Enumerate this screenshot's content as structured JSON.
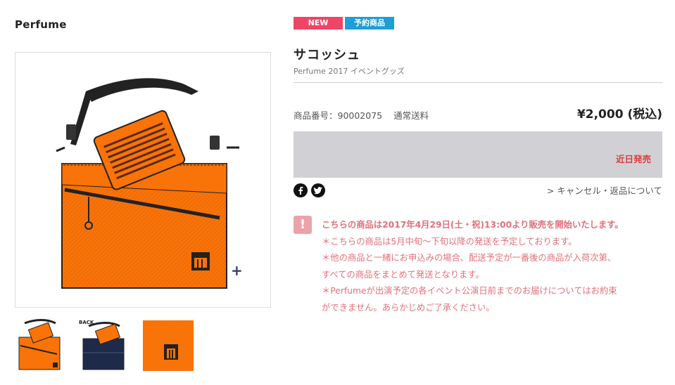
{
  "brand": "Perfume",
  "badges": {
    "new": "NEW",
    "preorder": "予約商品"
  },
  "product": {
    "title": "サコッシュ",
    "subtitle": "Perfume 2017 イベントグッズ",
    "number_label": "商品番号：90002075",
    "shipping": "通常送料",
    "price": "¥2,000 (税込)",
    "status": "近日発売"
  },
  "links": {
    "cancel": "> キャンセル・返品について"
  },
  "social": {
    "facebook_icon": "facebook-icon",
    "twitter_icon": "twitter-icon"
  },
  "gallery": {
    "zoom": "+",
    "thumb_back_label": "BACK"
  },
  "notice": {
    "icon": "!",
    "headline": "こちらの商品は2017年4月29日(土・祝)13:00より販売を開始いたします。",
    "lines": [
      "＊こちらの商品は5月中旬〜下旬以降の発送を予定しております。",
      "＊他の商品と一緒にお申込みの場合、配送予定が一番後の商品が入荷次第、",
      "すべての商品をまとめて発送となります。",
      "＊Perfumeが出演予定の各イベント公演日前までのお届けについてはお約束",
      "ができません。あらかじめご了承ください。"
    ]
  },
  "colors": {
    "accent_orange": "#f97308",
    "badge_new": "#ef4566",
    "badge_preorder": "#1e9ed6",
    "status_red": "#e03a3a",
    "notice_pink": "#e0707a",
    "navy": "#1d2a4a"
  }
}
